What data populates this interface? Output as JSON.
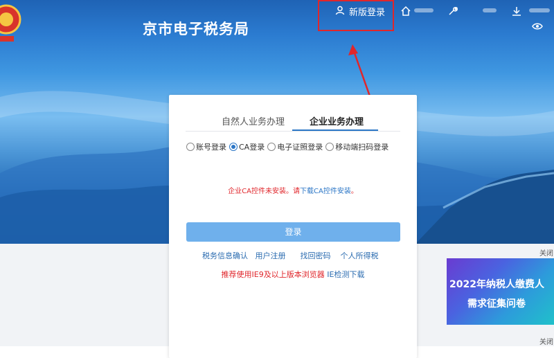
{
  "header": {
    "site_title": "京市电子税务局",
    "new_login_label": "新版登录"
  },
  "icons": {
    "home": "home-icon",
    "user": "user-icon",
    "wrench": "wrench-icon",
    "download": "download-icon",
    "eye": "eye-icon"
  },
  "login": {
    "tabs": [
      "自然人业务办理",
      "企业业务办理"
    ],
    "active_tab": "企业业务办理",
    "methods": [
      "账号登录",
      "CA登录",
      "电子证照登录",
      "移动端扫码登录"
    ],
    "selected_method": "CA登录",
    "warning_prefix": "企业CA控件未安装。请",
    "warning_link": "下载CA控件安装",
    "warning_suffix": "。",
    "submit_label": "登录",
    "links": [
      "税务信息确认",
      "用户注册",
      "找回密码",
      "个人所得税"
    ],
    "recommend_text": "推荐使用IE9及以上版本浏览器",
    "ie_check_link": "IE检测下载"
  },
  "sidebar": {
    "close_label_1": "关闭",
    "close_label_2": "关闭",
    "banner_line1": "2022年纳税人缴费人",
    "banner_line2": "需求征集问卷"
  },
  "colors": {
    "accent_blue": "#2b76c6",
    "button_blue": "#6fb0ec",
    "warning_red": "#e0262b",
    "highlight_red": "#e0262b"
  }
}
